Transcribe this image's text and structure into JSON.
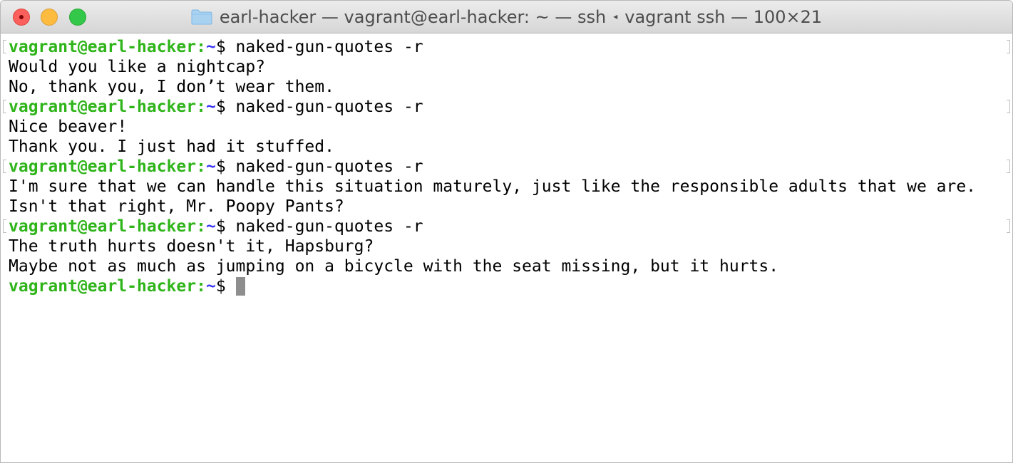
{
  "window": {
    "title_left": "earl-hacker — vagrant@earl-hacker: ~ — ssh",
    "title_sep": "◂",
    "title_right": "vagrant ssh — 100×21",
    "folder_icon": "folder-icon"
  },
  "prompt": {
    "user_host": "vagrant@earl-hacker",
    "colon": ":",
    "path": "~",
    "symbol": "$"
  },
  "entries": [
    {
      "command": "naked-gun-quotes -r",
      "output": [
        "Would you like a nightcap?",
        "No, thank you, I don’t wear them."
      ]
    },
    {
      "command": "naked-gun-quotes -r",
      "output": [
        "Nice beaver!",
        "Thank you. I just had it stuffed."
      ]
    },
    {
      "command": "naked-gun-quotes -r",
      "output": [
        "I'm sure that we can handle this situation maturely, just like the responsible adults that we are.",
        "Isn't that right, Mr. Poopy Pants?"
      ]
    },
    {
      "command": "naked-gun-quotes -r",
      "output": [
        "The truth hurts doesn't it, Hapsburg?",
        "Maybe not as much as jumping on a bicycle with the seat missing, but it hurts."
      ]
    }
  ],
  "colors": {
    "user_host": "#2fb41a",
    "path": "#3c36f5",
    "cursor": "#8e8e8e",
    "close": "#fc605c",
    "minimize": "#fdbc40",
    "maximize": "#34c84a"
  }
}
